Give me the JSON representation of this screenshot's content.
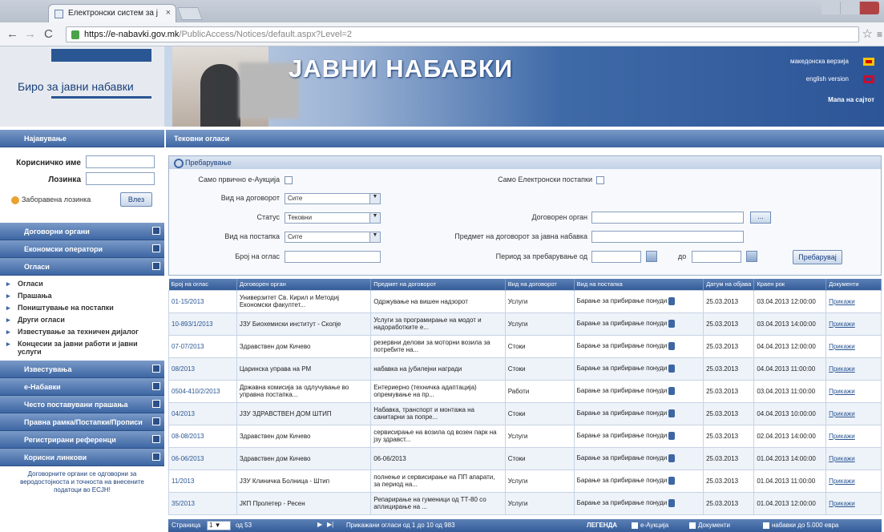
{
  "browser": {
    "tab_title": "Електронски систем за ј",
    "tab_close": "×",
    "url_host": "https://e-nabavki.gov.mk",
    "url_path": "/PublicAccess/Notices/default.aspx?Level=2"
  },
  "header": {
    "org_name": "Биро за јавни набавки",
    "banner_title": "ЈАВНИ НАБАВКИ",
    "lang_mk": "македонска верзија",
    "lang_en": "english version",
    "site_map": "Мапа на сајтот"
  },
  "sidebar": {
    "login_header": "Најавување",
    "username_label": "Корисничко име",
    "password_label": "Лозинка",
    "forgot_password": "Заборавена лозинка",
    "login_button": "Влез",
    "sections": [
      "Договорни органи",
      "Економски оператори",
      "Огласи"
    ],
    "notice_items": [
      "Огласи",
      "Прашања",
      "Поништување на постапки",
      "Други огласи",
      "Известување за техничен дијалог",
      "Концесии за јавни работи и јавни услуги"
    ],
    "lower_sections": [
      "Известувања",
      "е-Набавки",
      "Често поставувани прашања",
      "Правна рамка/Постапки/Прописи",
      "Регистрирани референци",
      "Корисни линкови"
    ],
    "footer": "Договорните органи се одговорни за веродостојноста и точноста на внесените податоци во ЕСЈН!"
  },
  "main": {
    "header": "Тековни огласи",
    "search_title": "Пребарување",
    "filters": {
      "only_eauction": "Само првично е-Аукција",
      "only_electronic": "Само Електронски постапки",
      "contract_type_label": "Вид на договорот",
      "contract_type_value": "Сите",
      "status_label": "Статус",
      "status_value": "Тековни",
      "procedure_type_label": "Вид на постапка",
      "procedure_type_value": "Сите",
      "notice_number_label": "Број на оглас",
      "contracting_authority_label": "Договорен орган",
      "subject_label": "Предмет на договорот за јавна набавка",
      "period_label": "Период за пребарување од",
      "period_to": "до",
      "dots_button": "...",
      "search_button": "Пребарувај"
    },
    "table": {
      "columns": [
        "Број на оглас",
        "Договорен орган",
        "Предмет на договорот",
        "Вид на договорот",
        "Вид на постапка",
        "Датум на објава",
        "Краен рок",
        "Документи"
      ],
      "rows": [
        [
          "01-15/2013",
          "Универзитет Св. Кирил и Методиј Економски факултет...",
          "Одржување на вишен надзорот",
          "Услуги",
          "Барање за прибирање понуди",
          "25.03.2013",
          "03.04.2013 12:00:00",
          "Прикажи"
        ],
        [
          "10-893/1/2013",
          "ЈЗУ Биохемиски институт - Скопје",
          "Услуги за програмирање на модот и надоработките е...",
          "Услуги",
          "Барање за прибирање понуди",
          "25.03.2013",
          "03.04.2013 14:00:00",
          "Прикажи"
        ],
        [
          "07-07/2013",
          "Здравствен дом Кичево",
          "резервни делови за моторни возила за потребите на...",
          "Стоки",
          "Барање за прибирање понуди",
          "25.03.2013",
          "04.04.2013 12:00:00",
          "Прикажи"
        ],
        [
          "08/2013",
          "Царинска управа на РМ",
          "набавка на јубилејни награди",
          "Стоки",
          "Барање за прибирање понуди",
          "25.03.2013",
          "04.04.2013 11:00:00",
          "Прикажи"
        ],
        [
          "0504-410/2/2013",
          "Државна комисија за одлучување во управна постапка...",
          "Ентериерно (техничка адаптација) опремување на пр...",
          "Работи",
          "Барање за прибирање понуди",
          "25.03.2013",
          "03.04.2013 11:00:00",
          "Прикажи"
        ],
        [
          "04/2013",
          "ЈЗУ ЗДРАВСТВЕН ДОМ ШТИП",
          "Набавка, транспорт и монтажа на санитарни за попре...",
          "Стоки",
          "Барање за прибирање понуди",
          "25.03.2013",
          "04.04.2013 10:00:00",
          "Прикажи"
        ],
        [
          "08-08/2013",
          "Здравствен дом Кичево",
          "сервисирање на возила од возен парк на јзу здравст...",
          "Услуги",
          "Барање за прибирање понуди",
          "25.03.2013",
          "02.04.2013 14:00:00",
          "Прикажи"
        ],
        [
          "06-06/2013",
          "Здравствен дом Кичево",
          "06-06/2013",
          "Стоки",
          "Барање за прибирање понуди",
          "25.03.2013",
          "01.04.2013 14:00:00",
          "Прикажи"
        ],
        [
          "11/2013",
          "ЈЗУ Клиничка Болница - Штип",
          "полнење и сервисирање на ПП апарати, за период на...",
          "Услуги",
          "Барање за прибирање понуди",
          "25.03.2013",
          "01.04.2013 11:00:00",
          "Прикажи"
        ],
        [
          "35/2013",
          "ЈКП Пролетер - Ресен",
          "Репарирање на гуменици од ТТ-80 со аплицирање на ...",
          "Услуги",
          "Барање за прибирање понуди",
          "25.03.2013",
          "01.04.2013 12:00:00",
          "Прикажи"
        ]
      ]
    },
    "pager": {
      "page_label": "Страница",
      "page_value": "1",
      "of_pages": "од 53",
      "summary": "Прикажани огласи од 1 до 10 од 983",
      "legend_label": "ЛЕГЕНДА",
      "legend_eauction": "е-Аукција",
      "legend_documents": "Документи",
      "legend_value": "набавки до 5.000 евра"
    }
  }
}
